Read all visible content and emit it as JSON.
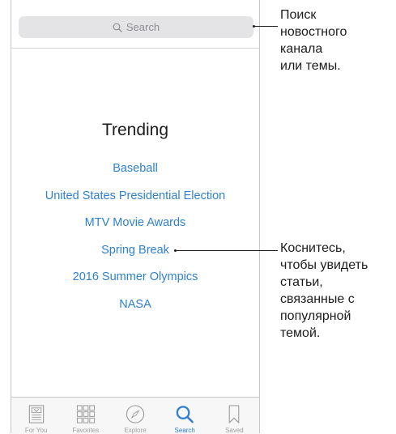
{
  "search": {
    "placeholder": "Search"
  },
  "trending": {
    "title": "Trending",
    "items": [
      "Baseball",
      "United States Presidential Election",
      "MTV Movie Awards",
      "Spring Break",
      "2016 Summer Olympics",
      "NASA"
    ]
  },
  "tabbar": {
    "tabs": [
      {
        "label": "For You",
        "icon": "for-you-icon",
        "active": false
      },
      {
        "label": "Favorites",
        "icon": "favorites-grid-icon",
        "active": false
      },
      {
        "label": "Explore",
        "icon": "compass-icon",
        "active": false
      },
      {
        "label": "Search",
        "icon": "search-icon",
        "active": true
      },
      {
        "label": "Saved",
        "icon": "bookmark-icon",
        "active": false
      }
    ]
  },
  "callouts": {
    "search_lines": [
      "Поиск",
      "новостного",
      "канала",
      "или темы."
    ],
    "trending_lines": [
      "Коснитесь,",
      "чтобы увидеть",
      "статьи,",
      "связанные с",
      "популярной",
      "темой."
    ]
  },
  "colors": {
    "accent": "#2f80d1",
    "inactive_tab": "#a0a0a0",
    "search_bg": "#e4e4e7"
  }
}
